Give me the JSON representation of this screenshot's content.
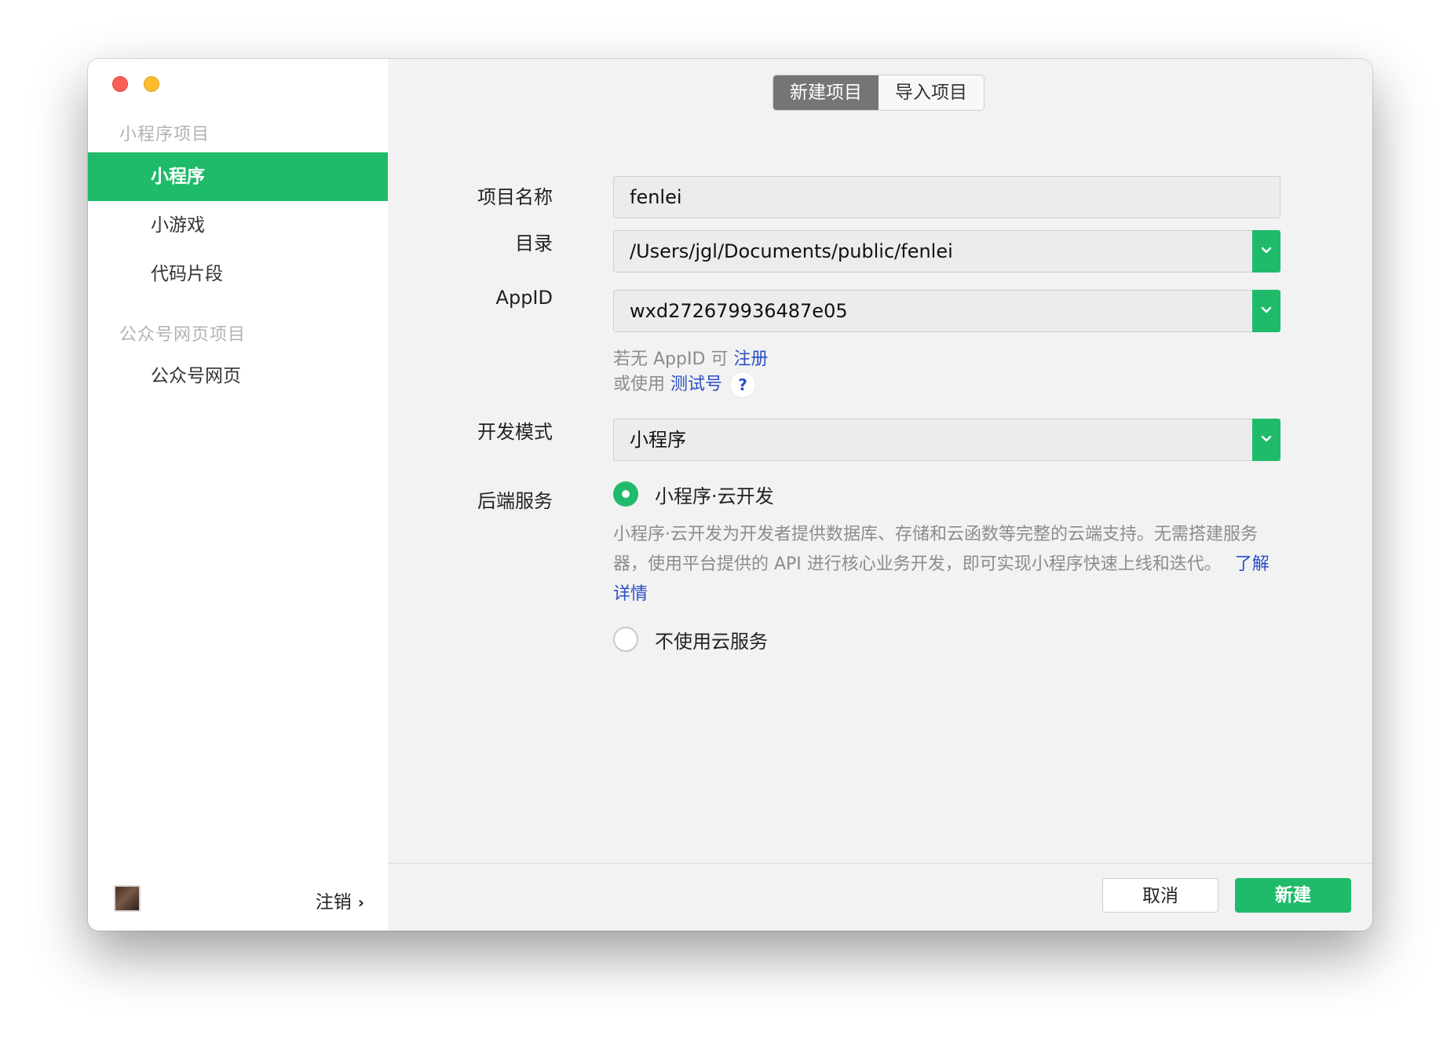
{
  "sidebar": {
    "sections": [
      {
        "title": "小程序项目",
        "items": [
          "小程序",
          "小游戏",
          "代码片段"
        ]
      },
      {
        "title": "公众号网页项目",
        "items": [
          "公众号网页"
        ]
      }
    ],
    "active_item": "小程序",
    "logout_label": "注销",
    "logout_chevron": "›"
  },
  "tabs": {
    "new_project": "新建项目",
    "import_project": "导入项目",
    "active": "新建项目"
  },
  "form": {
    "project_name": {
      "label": "项目名称",
      "value": "fenlei"
    },
    "directory": {
      "label": "目录",
      "value": "/Users/jgl/Documents/public/fenlei"
    },
    "appid": {
      "label": "AppID",
      "value": "wxd272679936487e05"
    },
    "appid_hint_1_prefix": "若无 AppID 可 ",
    "appid_hint_1_link": "注册",
    "appid_hint_2_prefix": "或使用 ",
    "appid_hint_2_link": "测试号",
    "help_icon": "?",
    "dev_mode": {
      "label": "开发模式",
      "value": "小程序"
    },
    "backend": {
      "label": "后端服务",
      "option_cloud": "小程序·云开发",
      "option_cloud_selected": true,
      "cloud_description": "小程序·云开发为开发者提供数据库、存储和云函数等完整的云端支持。无需搭建服务器，使用平台提供的 API 进行核心业务开发，即可实现小程序快速上线和迭代。",
      "learn_more": "了解详情",
      "option_none": "不使用云服务"
    }
  },
  "footer": {
    "cancel": "取消",
    "create": "新建"
  },
  "colors": {
    "accent": "#1fbb6a",
    "link": "#2b4fc7",
    "segment_active": "#757575"
  }
}
